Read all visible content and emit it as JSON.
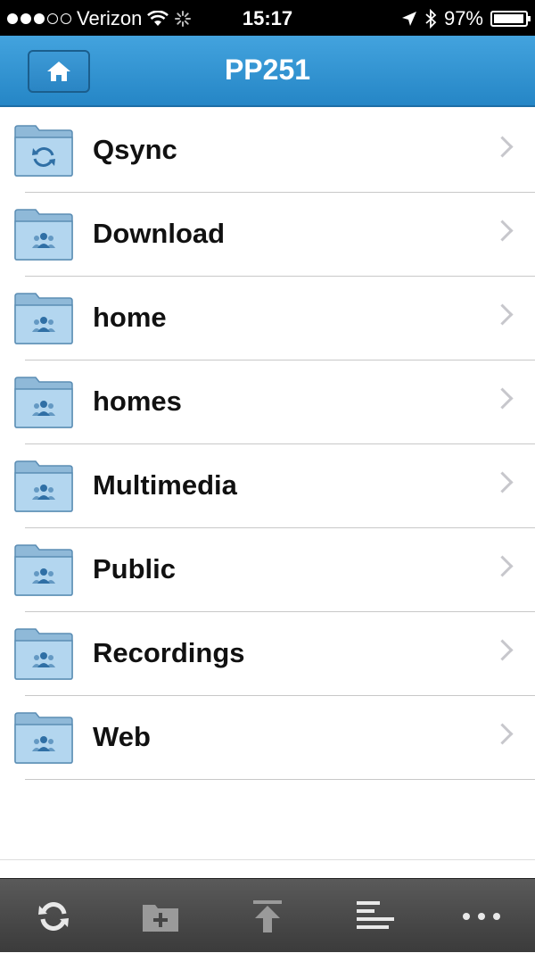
{
  "status_bar": {
    "carrier": "Verizon",
    "time": "15:17",
    "battery": "97%",
    "battery_level": 0.97
  },
  "nav": {
    "title": "PP251",
    "home_icon": "home-icon"
  },
  "folders": [
    {
      "label": "Qsync",
      "icon": "sync-folder-icon"
    },
    {
      "label": "Download",
      "icon": "shared-folder-icon"
    },
    {
      "label": "home",
      "icon": "shared-folder-icon"
    },
    {
      "label": "homes",
      "icon": "shared-folder-icon"
    },
    {
      "label": "Multimedia",
      "icon": "shared-folder-icon"
    },
    {
      "label": "Public",
      "icon": "shared-folder-icon"
    },
    {
      "label": "Recordings",
      "icon": "shared-folder-icon"
    },
    {
      "label": "Web",
      "icon": "shared-folder-icon"
    }
  ],
  "toolbar": {
    "buttons": [
      "refresh-icon",
      "new-folder-icon",
      "upload-icon",
      "sort-icon",
      "more-icon"
    ]
  },
  "colors": {
    "nav_bar": "#2e8fd0",
    "toolbar": "#4a4a4a"
  }
}
